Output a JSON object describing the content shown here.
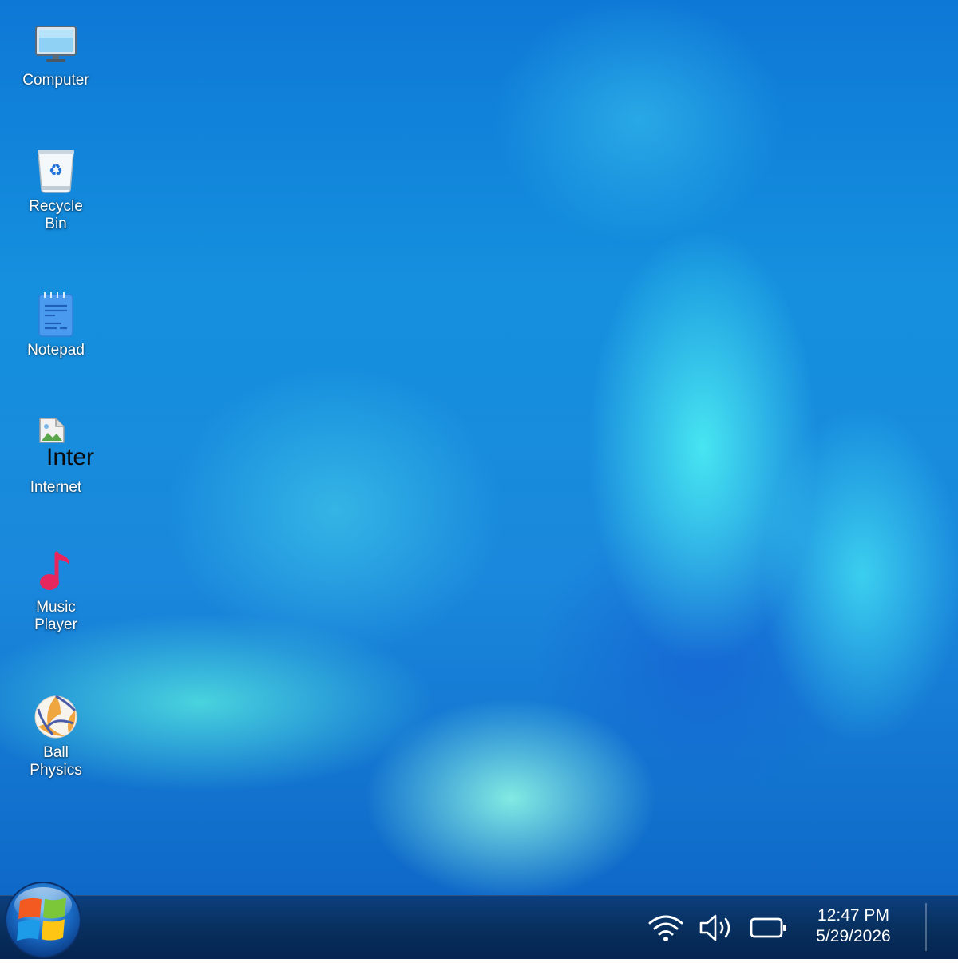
{
  "desktop": {
    "icons": [
      {
        "label": "Computer",
        "icon": "monitor-icon"
      },
      {
        "label": "Recycle Bin",
        "icon": "recycle-bin-icon"
      },
      {
        "label": "Notepad",
        "icon": "notepad-icon"
      },
      {
        "label": "Internet",
        "icon": "broken-image-icon",
        "alt_text": "Inter"
      },
      {
        "label": "Music Player",
        "icon": "music-note-icon"
      },
      {
        "label": "Ball Physics",
        "icon": "volleyball-icon"
      }
    ]
  },
  "taskbar": {
    "start_icon": "windows-logo-icon",
    "tray": {
      "wifi_icon": "wifi-icon",
      "volume_icon": "speaker-icon",
      "battery_icon": "battery-icon"
    },
    "clock": {
      "time": "12:47 PM",
      "date": "5/29/2026"
    }
  },
  "colors": {
    "taskbar": "#08305f",
    "music_note": "#e8265e",
    "desktop_accent": "#1590de"
  }
}
